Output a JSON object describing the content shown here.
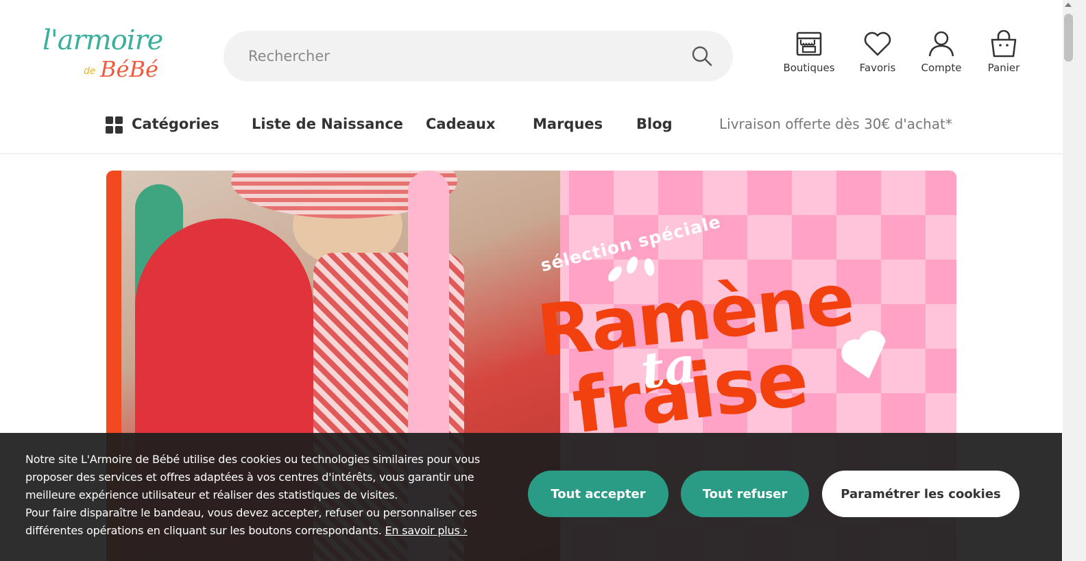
{
  "logo": {
    "line1": "l'armoire",
    "de": "de",
    "line2": "BéBé"
  },
  "search": {
    "placeholder": "Rechercher"
  },
  "header_icons": [
    {
      "label": "Boutiques",
      "icon": "store-icon"
    },
    {
      "label": "Favoris",
      "icon": "heart-icon"
    },
    {
      "label": "Compte",
      "icon": "user-icon"
    },
    {
      "label": "Panier",
      "icon": "basket-icon"
    }
  ],
  "nav": {
    "categories": "Catégories",
    "items": [
      "Liste de Naissance",
      "Cadeaux",
      "Marques",
      "Blog"
    ],
    "promo": "Livraison offerte dès 30€ d'achat*"
  },
  "banner": {
    "kicker": "sélection spéciale",
    "title_1": "Ramène",
    "title_2": "ta",
    "title_3": "fraise"
  },
  "cookie": {
    "message": "Notre site L'Armoire de Bébé utilise des cookies ou technologies similaires pour vous proposer des services et offres adaptées à vos centres d'intérêts, vous garantir une meilleure expérience utilisateur et réaliser des statistiques de visites.",
    "message2": "Pour faire disparaître le bandeau, vous devez accepter, refuser ou personnaliser ces différentes opérations en cliquant sur les boutons correspondants.",
    "learn_more": "En savoir plus ›",
    "accept": "Tout accepter",
    "refuse": "Tout refuser",
    "settings": "Paramétrer les cookies"
  },
  "colors": {
    "brand_teal": "#3aaf9b",
    "brand_coral": "#f05a3c",
    "button_green": "#2a9c86",
    "banner_red": "#f2410f",
    "banner_pink": "#ffb6cf"
  }
}
